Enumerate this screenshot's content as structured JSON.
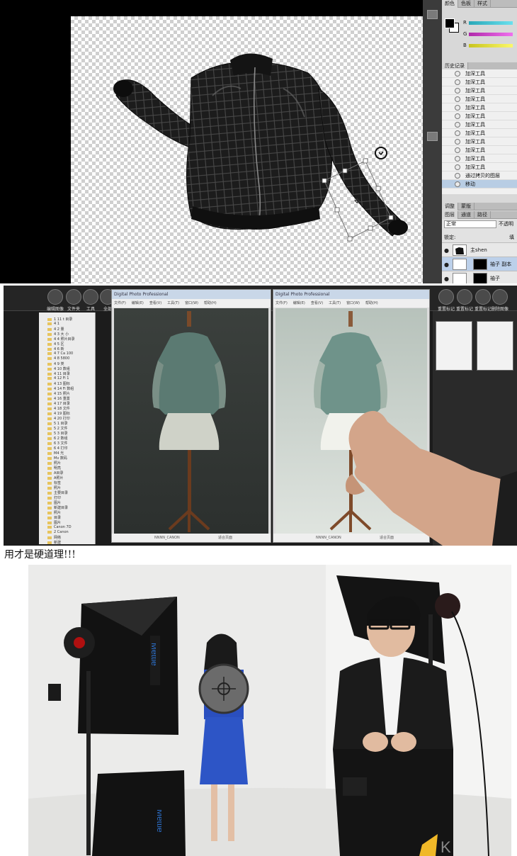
{
  "photoshop": {
    "color_panel": {
      "tabs": [
        "颜色",
        "色板",
        "样式"
      ],
      "slider_labels": [
        "R",
        "G",
        "B"
      ],
      "colors": {
        "r": "#42c8d8",
        "g": "#d44ad0",
        "b": "#e6e23a"
      }
    },
    "history_panel": {
      "title": "历史记录",
      "items": [
        "加深工具",
        "加深工具",
        "加深工具",
        "加深工具",
        "加深工具",
        "加深工具",
        "加深工具",
        "加深工具",
        "加深工具",
        "加深工具",
        "加深工具",
        "加深工具",
        "通过拷贝的图层",
        "移动"
      ],
      "selected_index": 13
    },
    "adjust_tabs": [
      "调整",
      "蒙版"
    ],
    "layers_panel": {
      "tabs": [
        "图层",
        "通道",
        "路径"
      ],
      "blend_mode": "正常",
      "opacity_label": "不透明",
      "lock_label": "锁定:",
      "fill_label": "填",
      "layers": [
        {
          "name": "主shen",
          "selected": false
        },
        {
          "name": "袖子 副本",
          "selected": true
        },
        {
          "name": "袖子",
          "selected": false
        }
      ]
    }
  },
  "dpp": {
    "toolbar": [
      "编辑图像",
      "文件夹",
      "工具",
      "全部",
      "重置标记",
      "重置标记",
      "重置标记",
      "删除图像",
      "主持"
    ],
    "folder_tree": [
      "1 11 t 目录",
      "4 1",
      "4 2 量",
      "4 3 大 小",
      "4 4 照片目录",
      "4 5 区",
      "4 6 新",
      "4 7 Ca 100",
      "4 8 5800",
      "4 9 类",
      "4 10 数组",
      "4 11 目录",
      "4 12 Fi 1",
      "4 13 图标",
      "4 14 Fi 数组",
      "4 15 照片",
      "4 16 重置",
      "4 17 目录",
      "4 18 文件",
      "4 19 图标",
      "4 20 打印",
      "5 1 目录",
      "5 2 文件",
      "5 3 目录",
      "6 2 数组",
      "6 3 文件",
      "6 4 打印",
      "M4 光",
      "Mv 数码",
      "照片",
      "明亮",
      "A目录",
      "A照片",
      "标签",
      "照片",
      "主要目录",
      "打印",
      "图片",
      "新建目录",
      "照片",
      "目录",
      "图片",
      "Canon 7D",
      "2 Canon",
      "网络",
      "新建"
    ],
    "window_title": "Digital Photo Professional",
    "window_menu": [
      "文件(F)",
      "编辑(E)",
      "查看(V)",
      "工具(T)",
      "窗口(W)",
      "帮助(H)"
    ],
    "status_left": "NNNN_CANON",
    "status_right": "适合页面"
  },
  "caption": "用才是硬道理!!!"
}
